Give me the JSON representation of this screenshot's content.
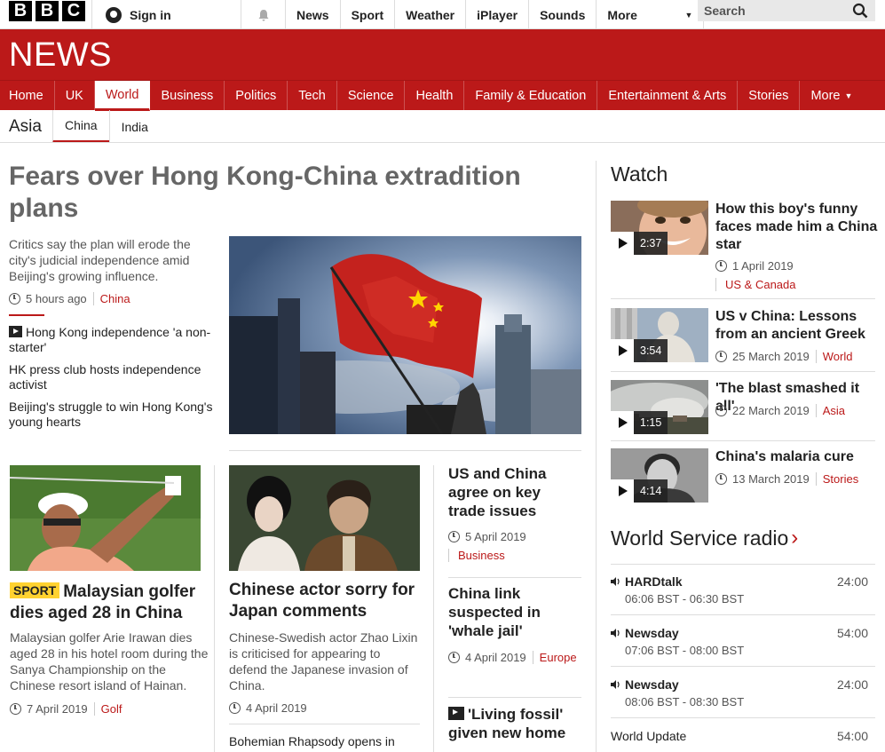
{
  "topbar": {
    "logo_letters": [
      "B",
      "B",
      "C"
    ],
    "signin": "Sign in",
    "nav": [
      "News",
      "Sport",
      "Weather",
      "iPlayer",
      "Sounds",
      "More"
    ],
    "search_placeholder": "Search"
  },
  "header": {
    "title": "NEWS"
  },
  "mainnav": [
    "Home",
    "UK",
    "World",
    "Business",
    "Politics",
    "Tech",
    "Science",
    "Health",
    "Family & Education",
    "Entertainment & Arts",
    "Stories",
    "More"
  ],
  "subnav": {
    "region": "Asia",
    "items": [
      "China",
      "India"
    ]
  },
  "lead": {
    "headline": "Fears over Hong Kong-China extradition plans",
    "summary": "Critics say the plan will erode the city's judicial independence amid Beijing's growing influence.",
    "time": "5 hours ago",
    "tag": "China",
    "related": [
      "Hong Kong independence 'a non-starter'",
      "HK press club hosts independence activist",
      "Beijing's struggle to win Hong Kong's young hearts"
    ]
  },
  "stories": [
    {
      "badge": "SPORT",
      "title": "Malaysian golfer dies aged 28 in China",
      "summary": "Malaysian golfer Arie Irawan dies aged 28 in his hotel room during the Sanya Championship on the Chinese resort island of Hainan.",
      "time": "7 April 2019",
      "tag": "Golf"
    },
    {
      "title": "Chinese actor sorry for Japan comments",
      "summary": "Chinese-Swedish actor Zhao Lixin is criticised for appearing to defend the Japanese invasion of China.",
      "time": "4 April 2019",
      "next": "Bohemian Rhapsody opens in"
    },
    {
      "title": "US and China agree on key trade issues",
      "time": "5 April 2019",
      "tag": "Business"
    },
    {
      "title": "China link suspected in 'whale jail'",
      "time": "4 April 2019",
      "tag": "Europe"
    },
    {
      "title": "'Living fossil' given new home"
    }
  ],
  "watch": {
    "heading": "Watch",
    "items": [
      {
        "title": "How this boy's funny faces made him a China star",
        "duration": "2:37",
        "time": "1 April 2019",
        "tag": "US & Canada"
      },
      {
        "title": "US v China: Lessons from an ancient Greek",
        "duration": "3:54",
        "time": "25 March 2019",
        "tag": "World"
      },
      {
        "title": "'The blast smashed it all'",
        "duration": "1:15",
        "time": "22 March 2019",
        "tag": "Asia"
      },
      {
        "title": "China's malaria cure",
        "duration": "4:14",
        "time": "13 March 2019",
        "tag": "Stories"
      }
    ]
  },
  "radio": {
    "heading": "World Service radio",
    "items": [
      {
        "name": "HARDtalk",
        "time": "06:06 BST - 06:30 BST",
        "duration": "24:00"
      },
      {
        "name": "Newsday",
        "time": "07:06 BST - 08:00 BST",
        "duration": "54:00"
      },
      {
        "name": "Newsday",
        "time": "08:06 BST - 08:30 BST",
        "duration": "24:00"
      },
      {
        "name": "World Update",
        "duration": "54:00"
      }
    ]
  },
  "colors": {
    "brand_red": "#bb1919",
    "sport_yellow": "#ffd230"
  }
}
